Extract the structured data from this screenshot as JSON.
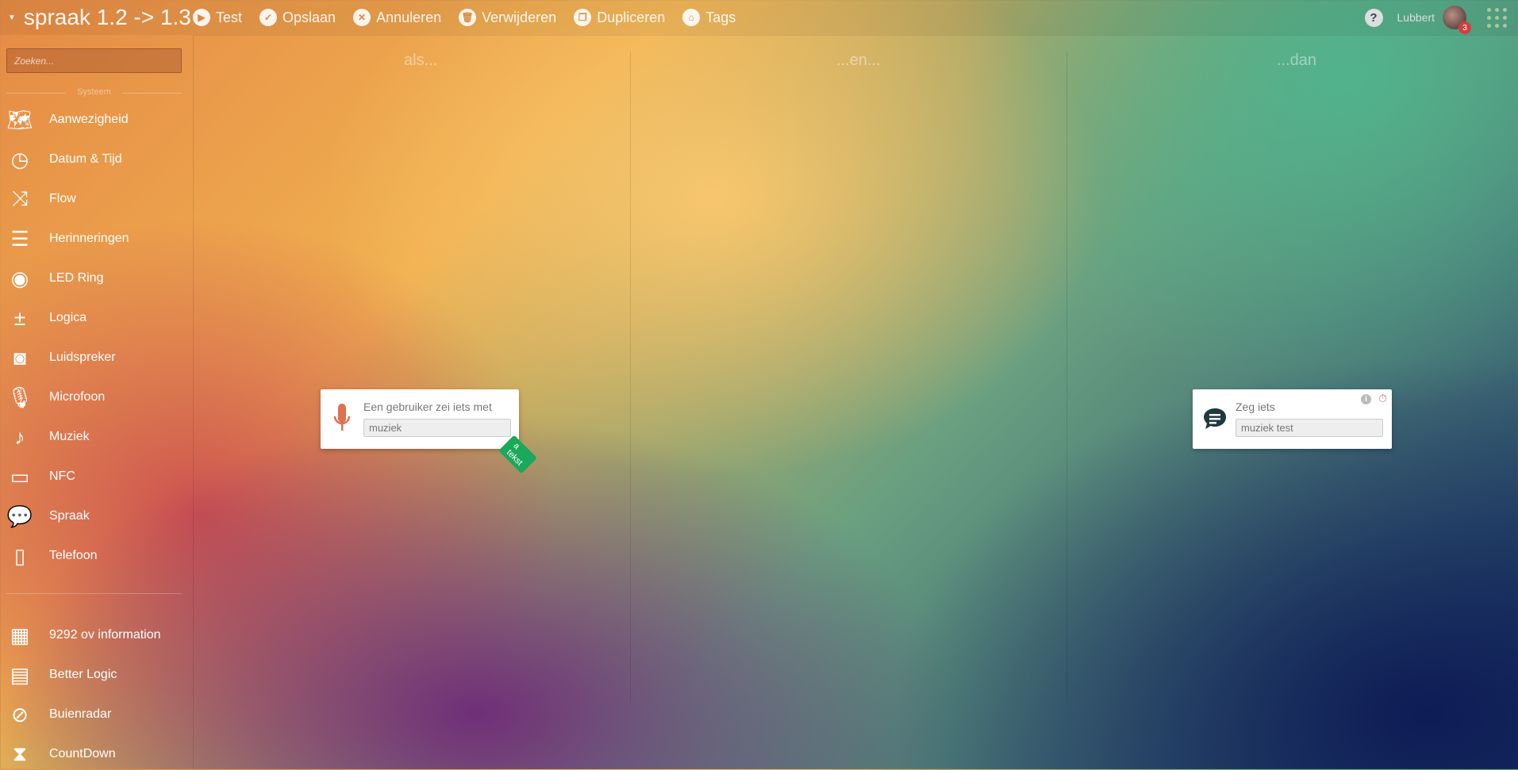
{
  "header": {
    "title": "spraak 1.2 -> 1.3",
    "buttons": [
      {
        "label": "Test",
        "icon": "play-icon"
      },
      {
        "label": "Opslaan",
        "icon": "check-icon"
      },
      {
        "label": "Annuleren",
        "icon": "close-icon"
      },
      {
        "label": "Verwijderen",
        "icon": "trash-icon"
      },
      {
        "label": "Dupliceren",
        "icon": "copy-icon"
      },
      {
        "label": "Tags",
        "icon": "tag-icon"
      }
    ],
    "help": "?",
    "user": "Lubbert",
    "notifications": "3"
  },
  "sidebar": {
    "search_placeholder": "Zoeken...",
    "section": "Systeem",
    "items": [
      {
        "label": "Aanwezigheid",
        "icon": "map-icon"
      },
      {
        "label": "Datum & Tijd",
        "icon": "clock-icon"
      },
      {
        "label": "Flow",
        "icon": "shuffle-icon"
      },
      {
        "label": "Herinneringen",
        "icon": "notepad-icon"
      },
      {
        "label": "LED Ring",
        "icon": "led-ring-icon"
      },
      {
        "label": "Logica",
        "icon": "math-icon"
      },
      {
        "label": "Luidspreker",
        "icon": "speaker-icon"
      },
      {
        "label": "Microfoon",
        "icon": "microphone-icon"
      },
      {
        "label": "Muziek",
        "icon": "music-note-icon"
      },
      {
        "label": "NFC",
        "icon": "nfc-icon"
      },
      {
        "label": "Spraak",
        "icon": "speech-bubble-icon"
      },
      {
        "label": "Telefoon",
        "icon": "phone-icon"
      }
    ],
    "apps": [
      {
        "label": "9292 ov information",
        "icon": "9292-icon"
      },
      {
        "label": "Better Logic",
        "icon": "calculator-icon"
      },
      {
        "label": "Buienradar",
        "icon": "buienradar-icon"
      },
      {
        "label": "CountDown",
        "icon": "hourglass-icon"
      }
    ]
  },
  "columns": [
    "als...",
    "...en...",
    "...dan"
  ],
  "cards": {
    "trigger": {
      "label": "Een gebruiker zei iets met",
      "value": "muziek",
      "tag": "a tekst"
    },
    "action": {
      "label": "Zeg iets",
      "value": "muziek test"
    }
  }
}
